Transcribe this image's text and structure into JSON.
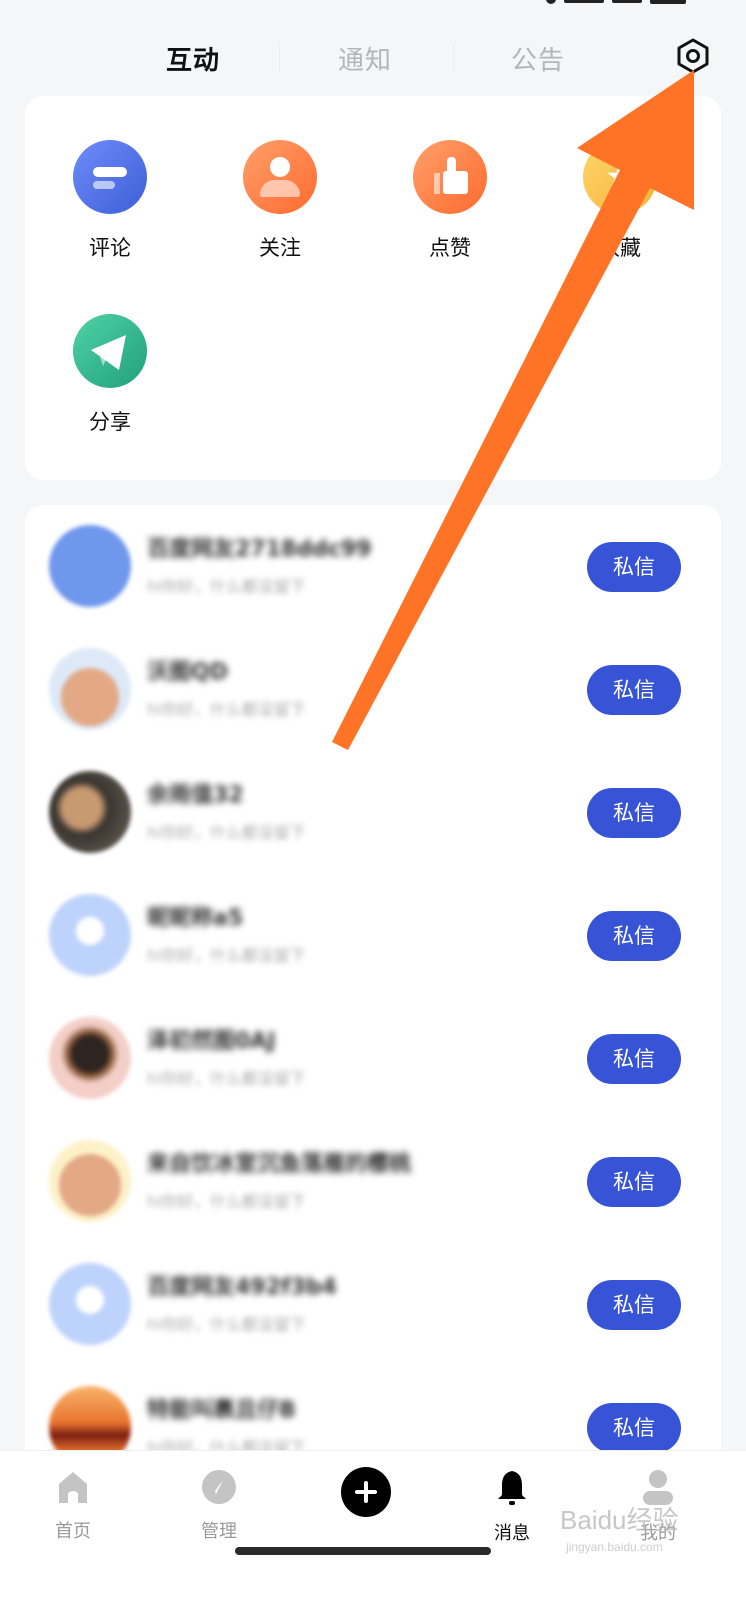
{
  "tabs": [
    {
      "label": "互动",
      "active": true
    },
    {
      "label": "通知",
      "active": false
    },
    {
      "label": "公告",
      "active": false
    }
  ],
  "settings_icon": "settings-hexagon-icon",
  "shortcuts": [
    {
      "label": "评论",
      "icon": "comment-icon",
      "color": "#4a6ae6"
    },
    {
      "label": "关注",
      "icon": "follow-person-icon",
      "color": "#ff7a3d"
    },
    {
      "label": "点赞",
      "icon": "thumbs-up-icon",
      "color": "#ff7a3d"
    },
    {
      "label": "收藏",
      "icon": "star-icon",
      "color": "#f8c14a"
    },
    {
      "label": "分享",
      "icon": "paper-plane-icon",
      "color": "#2fb588"
    }
  ],
  "followers": [
    {
      "name": "百度网友2718ddc99",
      "subtitle": "hi你好，什么都没留下",
      "dm_label": "私信"
    },
    {
      "name": "沃图QD",
      "subtitle": "hi你好，什么都没留下",
      "dm_label": "私信"
    },
    {
      "name": "余雨值32",
      "subtitle": "hi你好，什么都没留下",
      "dm_label": "私信"
    },
    {
      "name": "昵昵称a5",
      "subtitle": "hi你好，什么都没留下",
      "dm_label": "私信"
    },
    {
      "name": "泽初然图0AJ",
      "subtitle": "hi你好，什么都没留下",
      "dm_label": "私信"
    },
    {
      "name": "来自饮冰室沉鱼落雁的樱桃",
      "subtitle": "hi你好，什么都没留下",
      "dm_label": "私信"
    },
    {
      "name": "百度网友492f3b4",
      "subtitle": "hi你好，什么都没留下",
      "dm_label": "私信"
    },
    {
      "name": "特能叫裹且仔B",
      "subtitle": "hi你好，什么都没留下",
      "dm_label": "私信"
    }
  ],
  "bottom_nav": [
    {
      "label": "首页",
      "icon": "home-icon",
      "active": false
    },
    {
      "label": "管理",
      "icon": "compass-icon",
      "active": false
    },
    {
      "label": "",
      "icon": "plus-icon",
      "active": false
    },
    {
      "label": "消息",
      "icon": "bell-icon",
      "active": true
    },
    {
      "label": "我的",
      "icon": "user-icon",
      "active": false
    }
  ],
  "watermark": {
    "brand": "Baidu经验",
    "url": "jingyan.baidu.com"
  },
  "colors": {
    "accent": "#3754d6",
    "annotation_arrow": "#ff7326"
  }
}
